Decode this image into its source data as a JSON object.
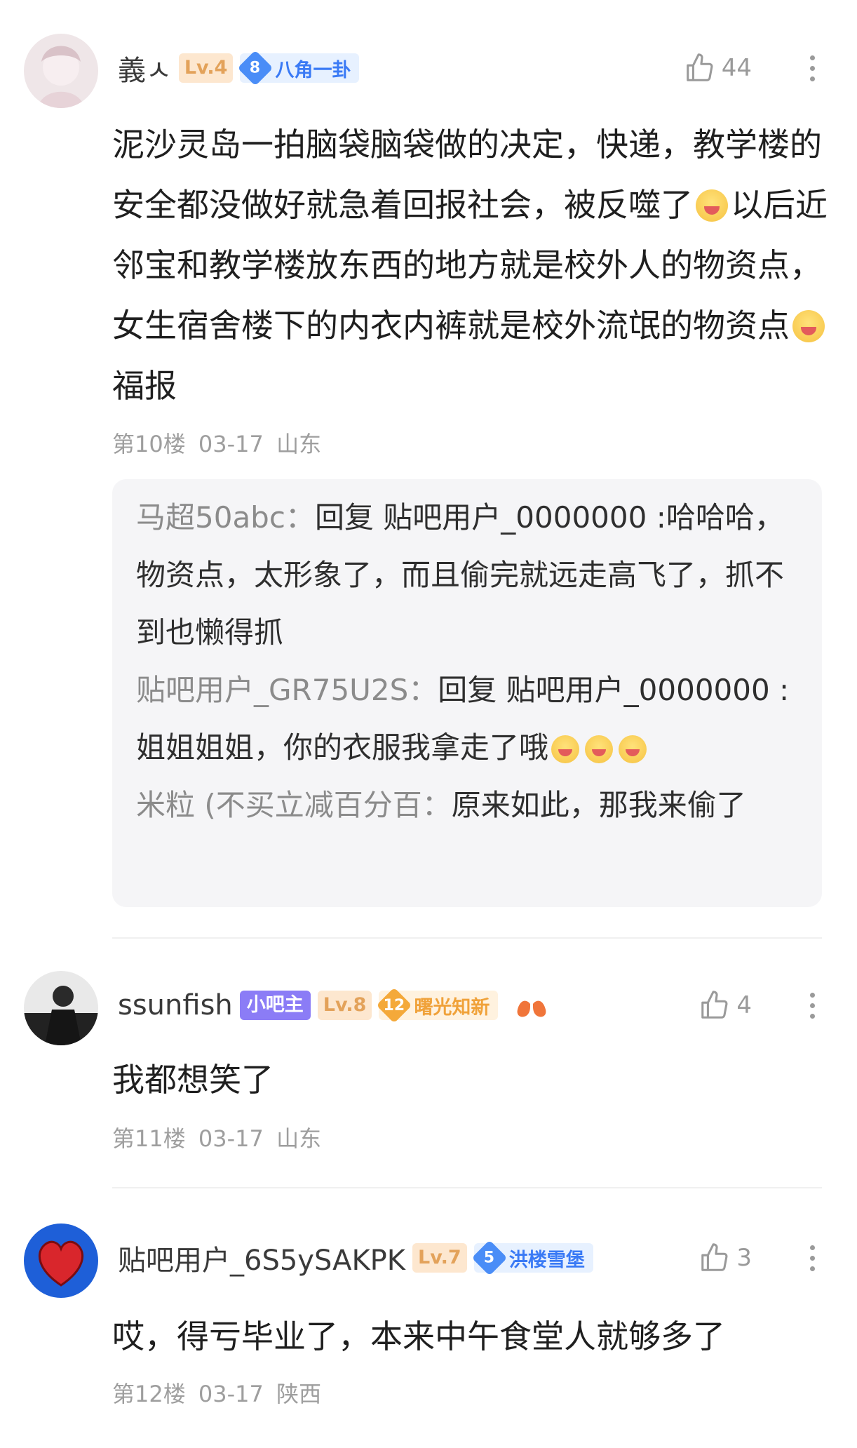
{
  "posts": [
    {
      "username": "義ㅅ",
      "level": "Lv.4",
      "title_num": "8",
      "title": "八角一卦",
      "likes": "44",
      "content": "泥沙灵岛一拍脑袋脑袋做的决定，快递，教学楼的安全都没做好就急着回报社会，被反噬了",
      "content2": "以后近邻宝和教学楼放东西的地方就是校外人的物资点，女生宿舍楼下的内衣内裤就是校外流氓的物资点",
      "content3": "福报",
      "floor": "第10楼",
      "date": "03-17",
      "location": "山东",
      "replies": [
        {
          "name": "马超50abc：",
          "text": "回复 贴吧用户_0000000 :哈哈哈，物资点，太形象了，而且偷完就远走高飞了，抓不到也懒得抓"
        },
        {
          "name": "贴吧用户_GR75U2S：",
          "text": "回复 贴吧用户_0000000 :姐姐姐姐，你的衣服我拿走了哦"
        },
        {
          "name": "米粒 (不买立减百分百：",
          "text": "原来如此，那我来偷了"
        }
      ]
    },
    {
      "username": "ssunfish",
      "role": "小吧主",
      "level": "Lv.8",
      "title_num": "12",
      "title": "曙光知新",
      "likes": "4",
      "content": "我都想笑了",
      "floor": "第11楼",
      "date": "03-17",
      "location": "山东"
    },
    {
      "username": "贴吧用户_6S5ySAKPK",
      "level": "Lv.7",
      "title_num": "5",
      "title": "洪楼雪堡",
      "likes": "3",
      "content": "哎，得亏毕业了，本来中午食堂人就够多了",
      "floor": "第12楼",
      "date": "03-17",
      "location": "陕西"
    }
  ]
}
